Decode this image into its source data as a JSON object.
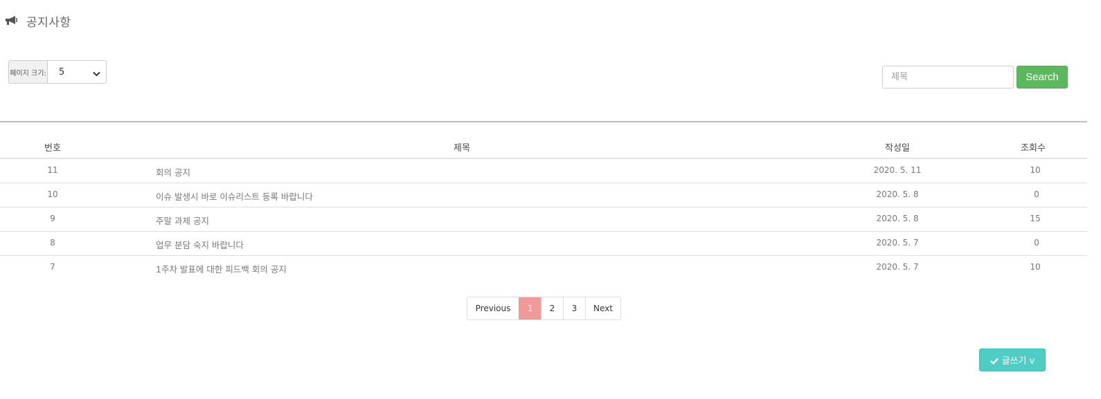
{
  "header": {
    "title": "공지사항",
    "icon": "megaphone-icon"
  },
  "page_size": {
    "label": "페이지 크기:",
    "selected": "5"
  },
  "search": {
    "placeholder": "제목",
    "button_label": "Search"
  },
  "table": {
    "columns": [
      "번호",
      "제목",
      "작성일",
      "조회수"
    ],
    "rows": [
      {
        "no": "11",
        "title": "회의 공지",
        "date": "2020. 5. 11",
        "views": "10"
      },
      {
        "no": "10",
        "title": "이슈 발생시 바로 이슈리스트 등록 바랍니다",
        "date": "2020. 5. 8",
        "views": "0"
      },
      {
        "no": "9",
        "title": "주말 과제 공지",
        "date": "2020. 5. 8",
        "views": "15"
      },
      {
        "no": "8",
        "title": "업무 분담 숙지 바랍니다",
        "date": "2020. 5. 7",
        "views": "0"
      },
      {
        "no": "7",
        "title": "1주차 발표에 대한 피드백 회의 공지",
        "date": "2020. 5. 7",
        "views": "10"
      }
    ]
  },
  "pagination": {
    "previous": "Previous",
    "pages": [
      "1",
      "2",
      "3"
    ],
    "active_page": "1",
    "next": "Next"
  },
  "write_button": {
    "label": "글쓰기 v",
    "icon": "check-icon"
  },
  "colors": {
    "search_button": "#5cb85c",
    "active_page": "#f19a9a",
    "write_button": "#4ecdc4"
  }
}
